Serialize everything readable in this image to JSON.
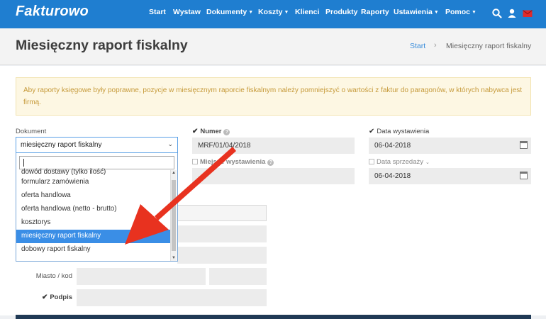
{
  "app": {
    "logo": "Fakturowo"
  },
  "nav": {
    "items": [
      {
        "label": "Start",
        "dropdown": false
      },
      {
        "label": "Wystaw",
        "dropdown": false
      },
      {
        "label": "Dokumenty",
        "dropdown": true
      },
      {
        "label": "Koszty",
        "dropdown": true
      },
      {
        "label": "Klienci",
        "dropdown": false
      },
      {
        "label": "Produkty",
        "dropdown": false
      },
      {
        "label": "Raporty",
        "dropdown": false
      },
      {
        "label": "Ustawienia",
        "dropdown": true
      },
      {
        "label": "Pomoc",
        "dropdown": true
      }
    ],
    "icons": [
      "search-icon",
      "user-icon",
      "mail-icon"
    ]
  },
  "header": {
    "title": "Miesięczny raport fiskalny",
    "breadcrumb": {
      "start": "Start",
      "separator": "›",
      "current": "Miesięczny raport fiskalny"
    }
  },
  "alert": {
    "text": "Aby raporty księgowe były poprawne, pozycje w miesięcznym raporcie fiskalnym należy pomniejszyć o wartości z faktur do paragonów, w których nabywca jest firmą."
  },
  "form": {
    "dokument": {
      "label": "Dokument",
      "selected": "miesięczny raport fiskalny",
      "options": [
        "dowód dostawy (tylko ilość)",
        "formularz zamówienia",
        "oferta handlowa",
        "oferta handlowa (netto - brutto)",
        "kosztorys",
        "miesięczny raport fiskalny",
        "dobowy raport fiskalny"
      ],
      "highlighted_index": 5
    },
    "numer": {
      "label": "Numer",
      "checked": true,
      "value": "MRF/01/04/2018"
    },
    "miejsce": {
      "label": "Miejsce wystawienia",
      "checked": false,
      "value": ""
    },
    "data_wystawienia": {
      "label": "Data wystawienia",
      "checked": true,
      "value": "06-04-2018"
    },
    "data_sprzedazy": {
      "label": "Data sprzedaży",
      "checked": false,
      "value": "06-04-2018"
    },
    "miasto": {
      "label": "Miasto / kod"
    },
    "podpis": {
      "label": "Podpis",
      "checked": true
    }
  },
  "colors": {
    "nav": "#1f7ed0",
    "highlight": "#3a8ee6",
    "annotation_arrow": "#e8321f",
    "alert_bg": "#fdf7e3"
  }
}
